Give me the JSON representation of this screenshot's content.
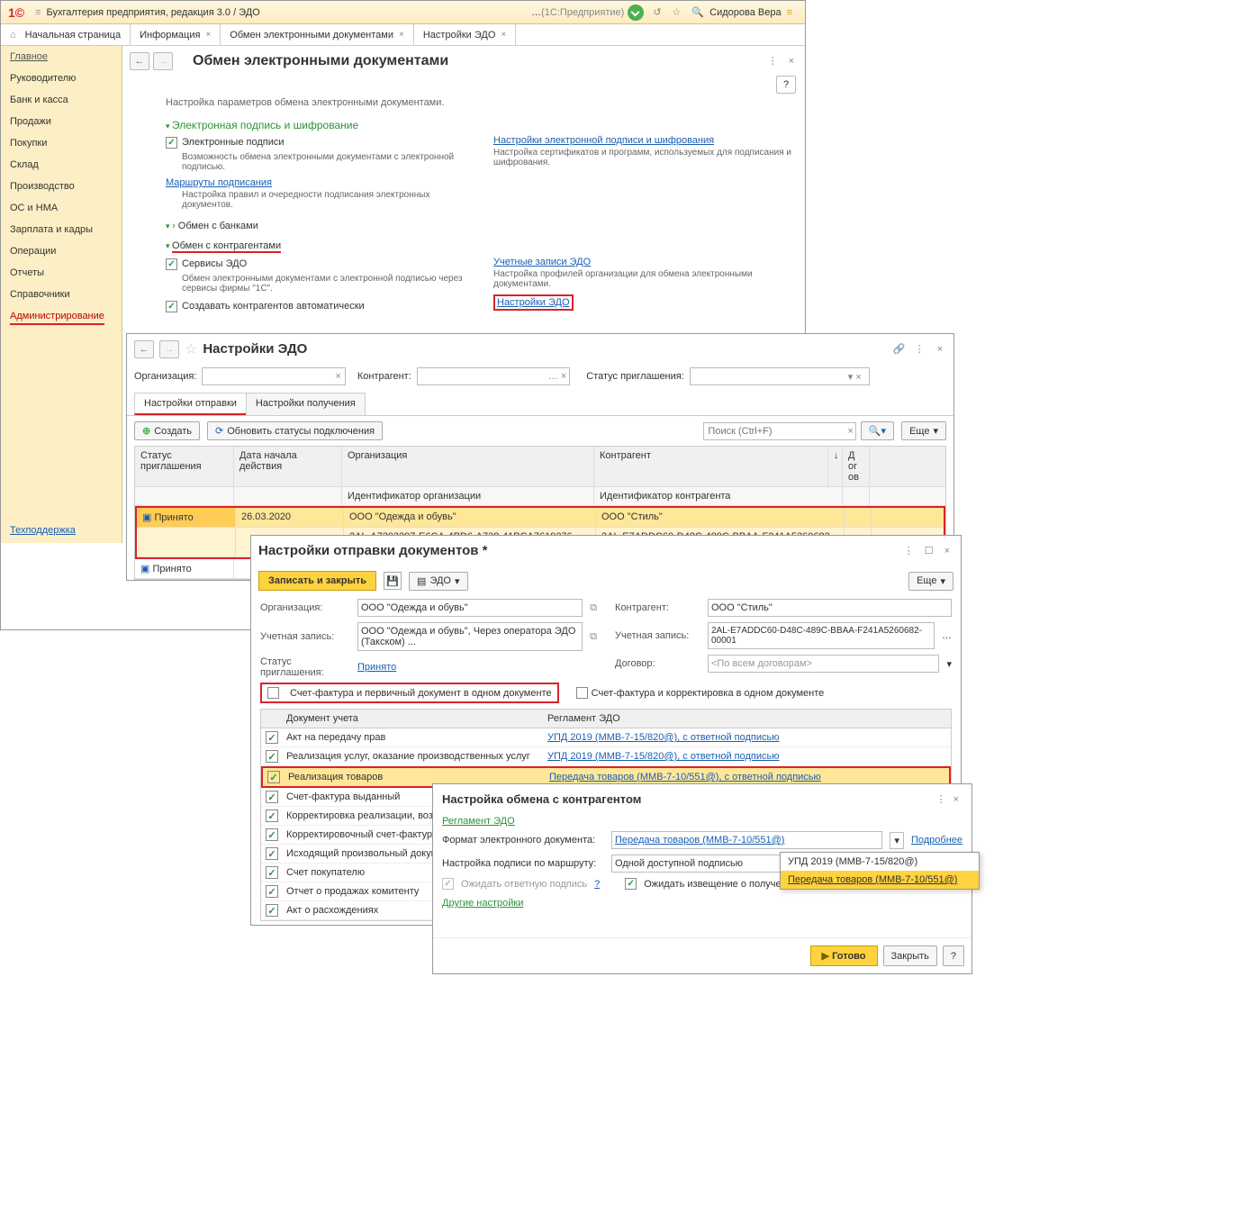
{
  "app": {
    "title": "Бухгалтерия предприятия, редакция 3.0 / ЭДО",
    "mode": "(1С:Предприятие)",
    "user": "Сидорова Вера"
  },
  "tabs": [
    "Начальная страница",
    "Информация",
    "Обмен электронными документами",
    "Настройки ЭДО"
  ],
  "sidebar": [
    "Главное",
    "Руководителю",
    "Банк и касса",
    "Продажи",
    "Покупки",
    "Склад",
    "Производство",
    "ОС и НМА",
    "Зарплата и кадры",
    "Операции",
    "Отчеты",
    "Справочники",
    "Администрирование"
  ],
  "support": "Техподдержка",
  "page": {
    "title": "Обмен электронными документами",
    "desc": "Настройка параметров обмена электронными документами.",
    "s1": {
      "title": "Электронная подпись и шифрование",
      "chk": "Электронные подписи",
      "l1": "Возможность обмена электронными документами с электронной подписью.",
      "lnk1": "Настройки электронной подписи и шифрования",
      "l2": "Настройка сертификатов и программ, используемых для подписания и шифрования.",
      "lnk2": "Маршруты подписания",
      "l3": "Настройка правил и очередности подписания электронных документов."
    },
    "s2": "Обмен с банками",
    "s3": {
      "title": "Обмен с контрагентами",
      "chk": "Сервисы ЭДО",
      "l1": "Обмен электронными документами с электронной подписью через сервисы фирмы \"1С\".",
      "chk2": "Создавать контрагентов автоматически",
      "lnk1": "Учетные записи ЭДО",
      "l2": "Настройка профилей организации для обмена электронными документами.",
      "lnk2": "Настройки ЭДО"
    },
    "help": "?"
  },
  "w2": {
    "title": "Настройки ЭДО",
    "org": "Организация:",
    "ctr": "Контрагент:",
    "stat": "Статус приглашения:",
    "tab1": "Настройки отправки",
    "tab2": "Настройки получения",
    "create": "Создать",
    "refresh": "Обновить статусы подключения",
    "search": "Поиск (Ctrl+F)",
    "more": "Еще",
    "th": [
      "Статус приглашения",
      "Дата начала действия",
      "Организация",
      "Контрагент",
      "Д ог ов"
    ],
    "th2": [
      "",
      "",
      "Идентификатор организации",
      "Идентификатор контрагента",
      ""
    ],
    "r1": {
      "s": "Принято",
      "d": "26.03.2020",
      "o": "ООО \"Одежда и обувь\"",
      "k": "ООО \"Стиль\""
    },
    "r1b": {
      "o": "2AL-A7303297-E6CA-4BD6-A738-41BCA7619276-00001",
      "k": "2AL-E7ADDC60-D48C-489C-BBAA-F241A5260682-00001"
    },
    "r2": {
      "s": "Принято"
    }
  },
  "w3": {
    "title": "Настройки отправки документов *",
    "save": "Записать и закрыть",
    "edo": "ЭДО",
    "more": "Еще",
    "org_l": "Организация:",
    "org_v": "ООО \"Одежда и обувь\"",
    "acc_l": "Учетная запись:",
    "acc_v": "ООО \"Одежда и обувь\", Через оператора ЭДО (Такском) ...",
    "st_l": "Статус приглашения:",
    "st_v": "Принято",
    "ctr_l": "Контрагент:",
    "ctr_v": "ООО \"Стиль\"",
    "acc2_l": "Учетная запись:",
    "acc2_v": "2AL-E7ADDC60-D48C-489C-BBAA-F241A5260682-00001",
    "dog_l": "Договор:",
    "dog_v": "<По всем договорам>",
    "c1": "Счет-фактура и первичный документ в одном документе",
    "c2": "Счет-фактура и корректировка в одном документе",
    "th": [
      "",
      "Документ учета",
      "Регламент ЭДО"
    ],
    "rows": [
      {
        "n": "Акт на передачу прав",
        "r": "УПД 2019 (ММВ-7-15/820@), с ответной подписью",
        "hl": 0
      },
      {
        "n": "Реализация услуг, оказание производственных услуг",
        "r": "УПД 2019 (ММВ-7-15/820@), с ответной подписью",
        "hl": 0
      },
      {
        "n": "Реализация товаров",
        "r": "Передача товаров (ММВ-7-10/551@), с ответной подписью",
        "hl": 1
      },
      {
        "n": "Счет-фактура выданный",
        "r": "",
        "hl": 0
      },
      {
        "n": "Корректировка реализации, воз",
        "r": "",
        "hl": 0
      },
      {
        "n": "Корректировочный счет-фактур",
        "r": "",
        "hl": 0
      },
      {
        "n": "Исходящий произвольный докум",
        "r": "",
        "hl": 0
      },
      {
        "n": "Счет покупателю",
        "r": "",
        "hl": 0
      },
      {
        "n": "Отчет о продажах комитенту",
        "r": "",
        "hl": 0
      },
      {
        "n": "Акт о расхождениях",
        "r": "",
        "hl": 0
      }
    ]
  },
  "w4": {
    "title": "Настройка обмена с контрагентом",
    "sec": "Регламент ЭДО",
    "more": "Подробнее",
    "other": "Другие настройки",
    "f1_l": "Формат электронного документа:",
    "f1_v": "Передача товаров (ММВ-7-10/551@)",
    "f2_l": "Настройка подписи по маршруту:",
    "f2_v": "Одной доступной подписью",
    "c1": "Ожидать ответную подпись",
    "c2": "Ожидать извещение о получении",
    "q": "?",
    "opts": [
      "УПД 2019 (ММВ-7-15/820@)",
      "Передача товаров (ММВ-7-10/551@)"
    ],
    "ready": "Готово",
    "close": "Закрыть",
    "help": "?"
  }
}
